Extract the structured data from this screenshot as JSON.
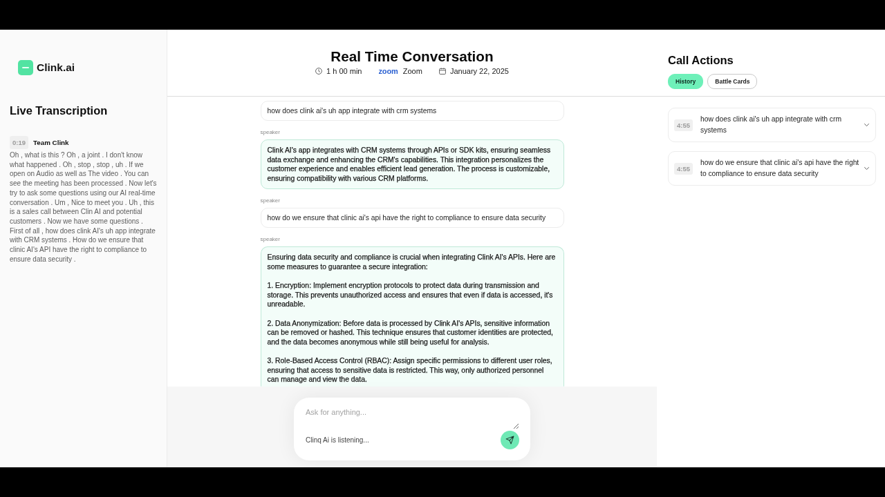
{
  "sidebar": {
    "brand": "Clink.ai",
    "heading": "Live Transcription",
    "entries": [
      {
        "time": "0:19",
        "speaker": "Team Clink",
        "text": "Oh , what is this ? Oh , a joint . I don't know what happened . Oh , stop , stop , uh . If we open on Audio as well as The video . You can see the meeting has been processed . Now let's try to ask some questions using our AI real-time conversation . Um , Nice to meet you . Uh , this is a sales call between Clin AI and potential customers . Now we have some questions . First of all , how does clink AI's uh app integrate with CRM systems . How do we ensure that clinic AI's API have the right to compliance to ensure data security ."
      }
    ]
  },
  "header": {
    "title": "Real Time Conversation",
    "meta": [
      {
        "kind": "duration",
        "text": "1 h 00 min"
      },
      {
        "kind": "platform",
        "logo": "zoom",
        "text": "Zoom"
      },
      {
        "kind": "date",
        "text": "January 22, 2025"
      }
    ]
  },
  "conversation": {
    "messages": [
      {
        "kind": "question",
        "text": "how does clink ai's uh app integrate with crm systems"
      },
      {
        "kind": "answer",
        "speaker": "speaker",
        "paragraphs": [
          "Clink AI's app integrates with CRM systems through APIs or SDK kits, ensuring seamless data exchange and enhancing the CRM's capabilities. This integration personalizes the customer experience and enables efficient lead generation. The process is customizable, ensuring compatibility with various CRM platforms."
        ]
      },
      {
        "kind": "question",
        "speaker": "speaker",
        "text": "how do we ensure that clinic ai's api have the right to compliance to ensure data security"
      },
      {
        "kind": "answer",
        "speaker": "speaker",
        "paragraphs": [
          "Ensuring data security and compliance is crucial when integrating Clink AI's APIs. Here are some measures to guarantee a secure integration:",
          "1. Encryption: Implement encryption protocols to protect data during transmission and storage. This prevents unauthorized access and ensures that even if data is accessed, it's unreadable.",
          "2. Data Anonymization: Before data is processed by Clink AI's APIs, sensitive information can be removed or hashed. This technique ensures that customer identities are protected, and the data becomes anonymous while still being useful for analysis.",
          "3. Role-Based Access Control (RBAC): Assign specific permissions to different user roles, ensuring that access to sensitive data is restricted. This way, only authorized personnel can manage and view the data."
        ]
      }
    ]
  },
  "composer": {
    "placeholder": "Ask for anything...",
    "status": "Clinq Ai is listening..."
  },
  "call_actions": {
    "title": "Call Actions",
    "tabs": [
      {
        "label": "History",
        "selected": true
      },
      {
        "label": "Battle Cards",
        "selected": false
      }
    ],
    "history": [
      {
        "time": "4:55",
        "text": "how does clink ai's uh app integrate with crm systems",
        "expanded": false
      },
      {
        "time": "4:55",
        "text": "how do we ensure that clinic ai's api have the right to compliance to ensure data security",
        "expanded": false
      }
    ]
  }
}
